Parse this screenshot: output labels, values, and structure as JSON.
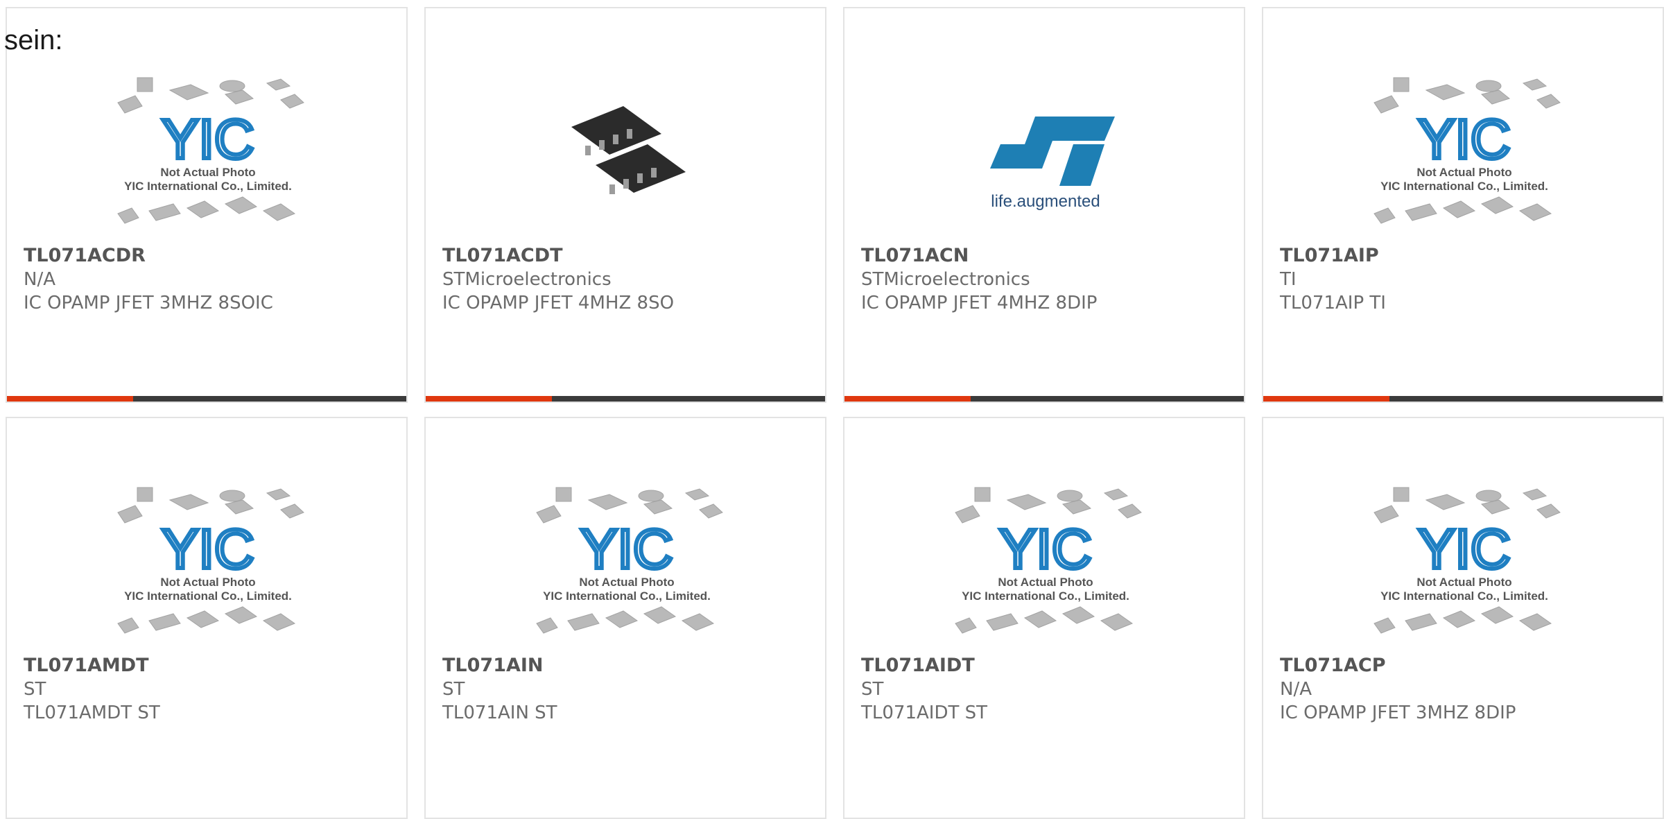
{
  "page_prefix": "sein:",
  "placeholder_text": {
    "line1": "Not Actual Photo",
    "line2": "YIC International Co., Limited.",
    "logo_text": "YIC"
  },
  "st_logo": {
    "tagline": "life.augmented"
  },
  "colors": {
    "accent": "#e0380f",
    "bar": "#3b3b3b",
    "yic_blue": "#1f7fc2",
    "st_blue": "#1e7fb4"
  },
  "products": [
    {
      "part": "TL071ACDR",
      "manufacturer": "N/A",
      "description": "IC OPAMP JFET 3MHZ 8SOIC",
      "image": "yic-placeholder"
    },
    {
      "part": "TL071ACDT",
      "manufacturer": "STMicroelectronics",
      "description": "IC OPAMP JFET 4MHZ 8SO",
      "image": "soic-chip-photo"
    },
    {
      "part": "TL071ACN",
      "manufacturer": "STMicroelectronics",
      "description": "IC OPAMP JFET 4MHZ 8DIP",
      "image": "st-logo"
    },
    {
      "part": "TL071AIP",
      "manufacturer": "TI",
      "description": "TL071AIP TI",
      "image": "yic-placeholder"
    },
    {
      "part": "TL071AMDT",
      "manufacturer": "ST",
      "description": "TL071AMDT ST",
      "image": "yic-placeholder"
    },
    {
      "part": "TL071AIN",
      "manufacturer": "ST",
      "description": "TL071AIN ST",
      "image": "yic-placeholder"
    },
    {
      "part": "TL071AIDT",
      "manufacturer": "ST",
      "description": "TL071AIDT ST",
      "image": "yic-placeholder"
    },
    {
      "part": "TL071ACP",
      "manufacturer": "N/A",
      "description": "IC OPAMP JFET 3MHZ 8DIP",
      "image": "yic-placeholder"
    }
  ]
}
